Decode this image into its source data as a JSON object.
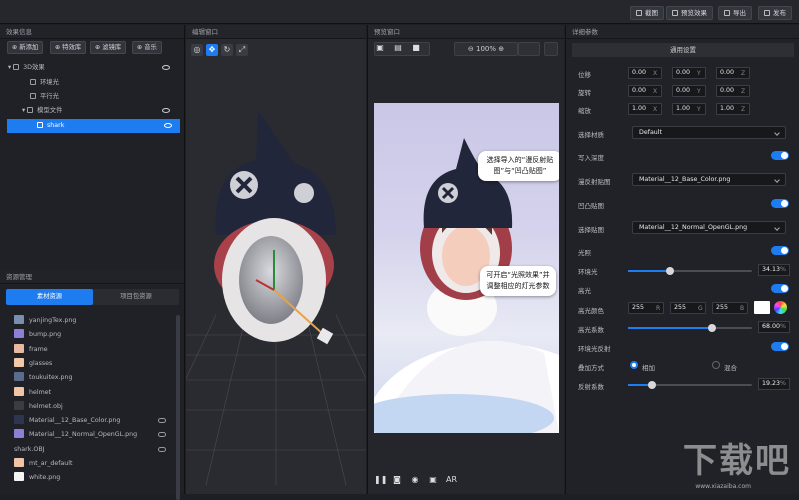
{
  "topbar": {
    "buttons": [
      {
        "label": "截图",
        "icon": "scissors-icon"
      },
      {
        "label": "预览效果",
        "icon": "preview-icon"
      },
      {
        "label": "导出",
        "icon": "export-icon"
      },
      {
        "label": "发布",
        "icon": "send-icon"
      }
    ]
  },
  "left": {
    "title": "效果信息",
    "add_buttons": [
      "新添加",
      "特效库",
      "滤镜库",
      "音乐"
    ],
    "tree": [
      {
        "label": "3D效果"
      },
      {
        "label": "环境光"
      },
      {
        "label": "平行光"
      },
      {
        "label": "模型文件"
      },
      {
        "label": "shark"
      }
    ],
    "resources_title": "资源管理",
    "tabs": [
      "素材资源",
      "项目包资源"
    ],
    "files": [
      {
        "name": "yanjingTex.png",
        "color": "#7a8fb0"
      },
      {
        "name": "bump.png",
        "color": "#8b7fd6"
      },
      {
        "name": "frame",
        "color": "#e8b9a0"
      },
      {
        "name": "glasses",
        "color": "#f2c9a8"
      },
      {
        "name": "toukuitex.png",
        "color": "#5a6b8c"
      },
      {
        "name": "helmet",
        "color": "#f0c4a4"
      },
      {
        "name": "helmet.obj",
        "color": "#3a3c43"
      },
      {
        "name": "Material__12_Base_Color.png",
        "color": "#2e3550"
      },
      {
        "name": "Material__12_Normal_OpenGL.png",
        "color": "#8b7fd6"
      },
      {
        "name": "shark.OBJ",
        "color": ""
      },
      {
        "name": "mt_ar_default",
        "color": "#f0c4a4"
      },
      {
        "name": "white.png",
        "color": "#f4f4f4"
      }
    ]
  },
  "editor": {
    "title": "编辑窗口"
  },
  "preview": {
    "title": "预览窗口",
    "zoom": "100%",
    "bubble1": "选择导入的“漫反射贴图”与“凹凸贴图”",
    "bubble2": "可开启“光照效果”并调整相应的灯光参数",
    "ar_label": "AR"
  },
  "props": {
    "title": "详细参数",
    "section": "通用设置",
    "position": {
      "label": "位移",
      "x": "0.00",
      "y": "0.00",
      "z": "0.00"
    },
    "rotation": {
      "label": "旋转",
      "x": "0.00",
      "y": "0.00",
      "z": "0.00"
    },
    "scale": {
      "label": "缩放",
      "x": "1.00",
      "y": "1.00",
      "z": "1.00"
    },
    "material": {
      "label": "选择材质",
      "value": "Default"
    },
    "depth_label": "写入深度",
    "diffuse": {
      "label": "漫反射贴图",
      "value": "Material__12_Base_Color.png"
    },
    "bump_label": "凹凸贴图",
    "bump": {
      "label": "选择贴图",
      "value": "Material__12_Normal_OpenGL.png"
    },
    "light_label": "光照",
    "ambient": {
      "label": "环境光",
      "value": "34.13",
      "level": 0.3413
    },
    "highlight_label": "高光",
    "hl_color": {
      "label": "高光颜色",
      "r": "255",
      "g": "255",
      "b": "255"
    },
    "hl_coef": {
      "label": "高光系数",
      "value": "68.00",
      "level": 0.68
    },
    "env_reflect_label": "环境光反射",
    "blend": {
      "label": "叠加方式",
      "opt1": "相加",
      "opt2": "混合"
    },
    "reflect": {
      "label": "反射系数",
      "value": "19.23",
      "level": 0.1923
    },
    "unit": "%"
  },
  "accent": "#1e7cf1",
  "watermark": {
    "text": "下载吧",
    "url": "www.xiazaiba.com"
  }
}
